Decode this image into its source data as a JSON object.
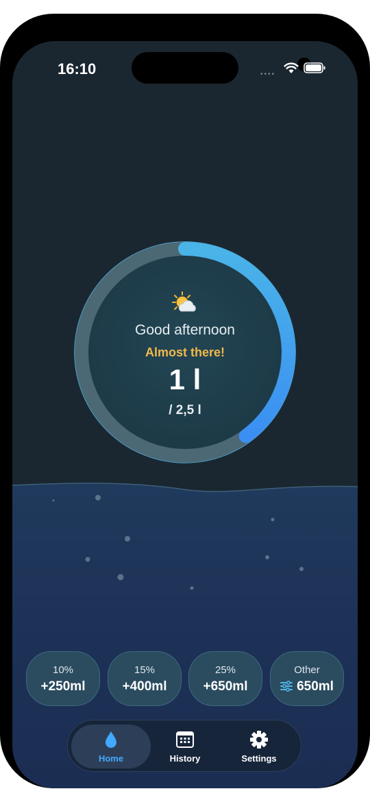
{
  "status_bar": {
    "time": "16:10",
    "signal": "••••"
  },
  "progress": {
    "fraction": 0.4,
    "accent_start": "#4ab4e8",
    "accent_end": "#3b8ff2",
    "weather_icon": "sun-behind-cloud-icon",
    "greeting": "Good afternoon",
    "motivation": "Almost there!",
    "motivation_color": "#f2b84a",
    "amount": "1 l",
    "goal": "/ 2,5 l"
  },
  "quick_add": [
    {
      "percent": "10%",
      "amount": "+250ml"
    },
    {
      "percent": "15%",
      "amount": "+400ml"
    },
    {
      "percent": "25%",
      "amount": "+650ml"
    },
    {
      "percent": "Other",
      "amount": "650ml",
      "icon": "sliders-icon"
    }
  ],
  "tabs": [
    {
      "label": "Home",
      "icon": "water-drop-icon",
      "active": true
    },
    {
      "label": "History",
      "icon": "calendar-icon",
      "active": false
    },
    {
      "label": "Settings",
      "icon": "gear-icon",
      "active": false
    }
  ]
}
